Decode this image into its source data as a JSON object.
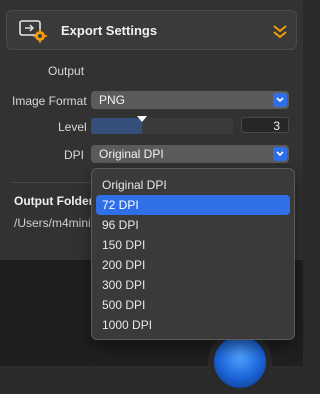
{
  "header": {
    "title": "Export Settings"
  },
  "output": {
    "label": "Output",
    "image_format_label": "Image Format",
    "image_format_value": "PNG",
    "level_label": "Level",
    "level_value": "3",
    "level_fraction": 0.36,
    "dpi_label": "DPI",
    "dpi_value": "Original DPI"
  },
  "output_folder": {
    "title": "Output Folder",
    "path": "/Users/m4mini"
  },
  "dpi_menu": {
    "items": [
      {
        "label": "Original DPI"
      },
      {
        "label": "72 DPI"
      },
      {
        "label": "96 DPI"
      },
      {
        "label": "150 DPI"
      },
      {
        "label": "200 DPI"
      },
      {
        "label": "300 DPI"
      },
      {
        "label": "500 DPI"
      },
      {
        "label": "1000 DPI"
      }
    ],
    "selected_index": 1
  },
  "colors": {
    "accent": "#2f6fe8",
    "chevron": "#f59e0b"
  }
}
